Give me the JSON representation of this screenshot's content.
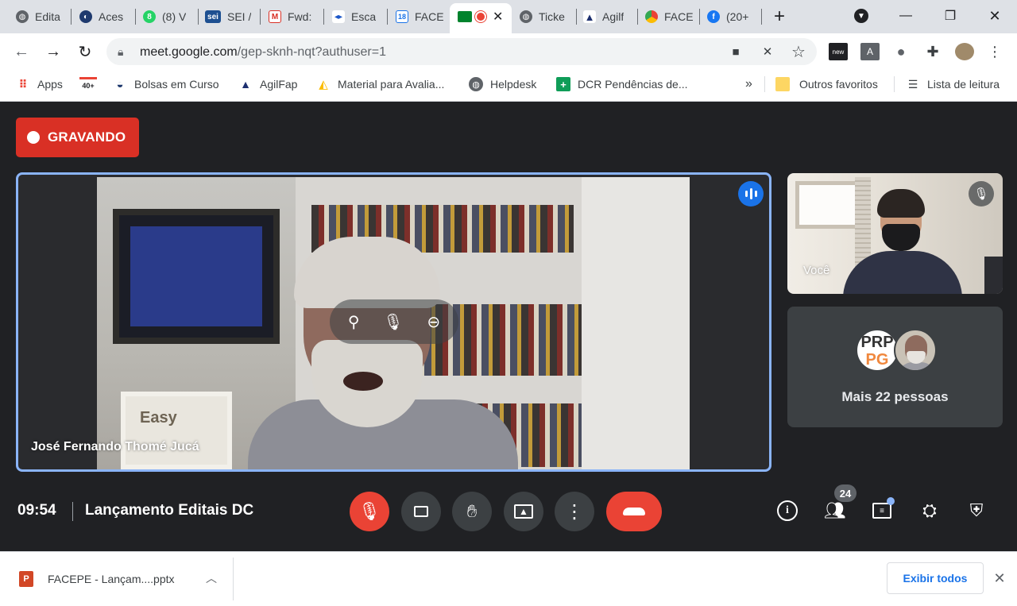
{
  "browser": {
    "tabs": [
      {
        "label": "Edita",
        "icon": "globe-icon"
      },
      {
        "label": "Aces",
        "icon": "site-icon"
      },
      {
        "label": "(8) V",
        "icon": "whatsapp-icon"
      },
      {
        "label": "SEI /",
        "icon": "sei-icon",
        "icon_text": "sei"
      },
      {
        "label": "Fwd:",
        "icon": "gmail-icon"
      },
      {
        "label": "Esca",
        "icon": "site-icon"
      },
      {
        "label": "FACE",
        "icon": "calendar-icon",
        "icon_text": "18"
      },
      {
        "label": "",
        "icon": "meet-icon",
        "active": true
      },
      {
        "label": "Ticke",
        "icon": "globe-icon"
      },
      {
        "label": "Agilf",
        "icon": "agilfap-icon"
      },
      {
        "label": "FACE",
        "icon": "chrome-icon"
      },
      {
        "label": "(20+",
        "icon": "facebook-icon"
      }
    ],
    "new_tab_symbol": "+",
    "url_host": "meet.google.com",
    "url_rest": "/gep-sknh-nqt?authuser=1",
    "bookmarks": [
      {
        "label": "Apps",
        "icon": "apps-grid-icon"
      },
      {
        "label": "",
        "icon": "gmail-icon",
        "icon_text": "40+"
      },
      {
        "label": "Bolsas em Curso",
        "icon": "site-icon"
      },
      {
        "label": "AgilFap",
        "icon": "agilfap-icon"
      },
      {
        "label": "Material para Avalia...",
        "icon": "drive-icon"
      },
      {
        "label": "Helpdesk",
        "icon": "globe-icon"
      },
      {
        "label": "DCR Pendências de...",
        "icon": "sheets-icon"
      }
    ],
    "bookmarks_overflow": "»",
    "other_bookmarks": "Outros favoritos",
    "reading_list": "Lista de leitura"
  },
  "meet": {
    "recording_label": "GRAVANDO",
    "main_speaker_name": "José Fernando Thomé Jucá",
    "poster_text": "Easy",
    "self_label": "Você",
    "more_people_label": "Mais 22 pessoas",
    "avatar_text_top": "PRP",
    "avatar_text_bottom": "PG",
    "time": "09:54",
    "meeting_title": "Lançamento Editais DC",
    "participants_count": "24"
  },
  "download": {
    "filename": "FACEPE - Lançam....pptx",
    "show_all_label": "Exibir todos"
  },
  "colors": {
    "recording_red": "#d93025",
    "end_call_red": "#ea4335",
    "active_speaker_border": "#8ab4f8",
    "meet_background": "#202124"
  }
}
